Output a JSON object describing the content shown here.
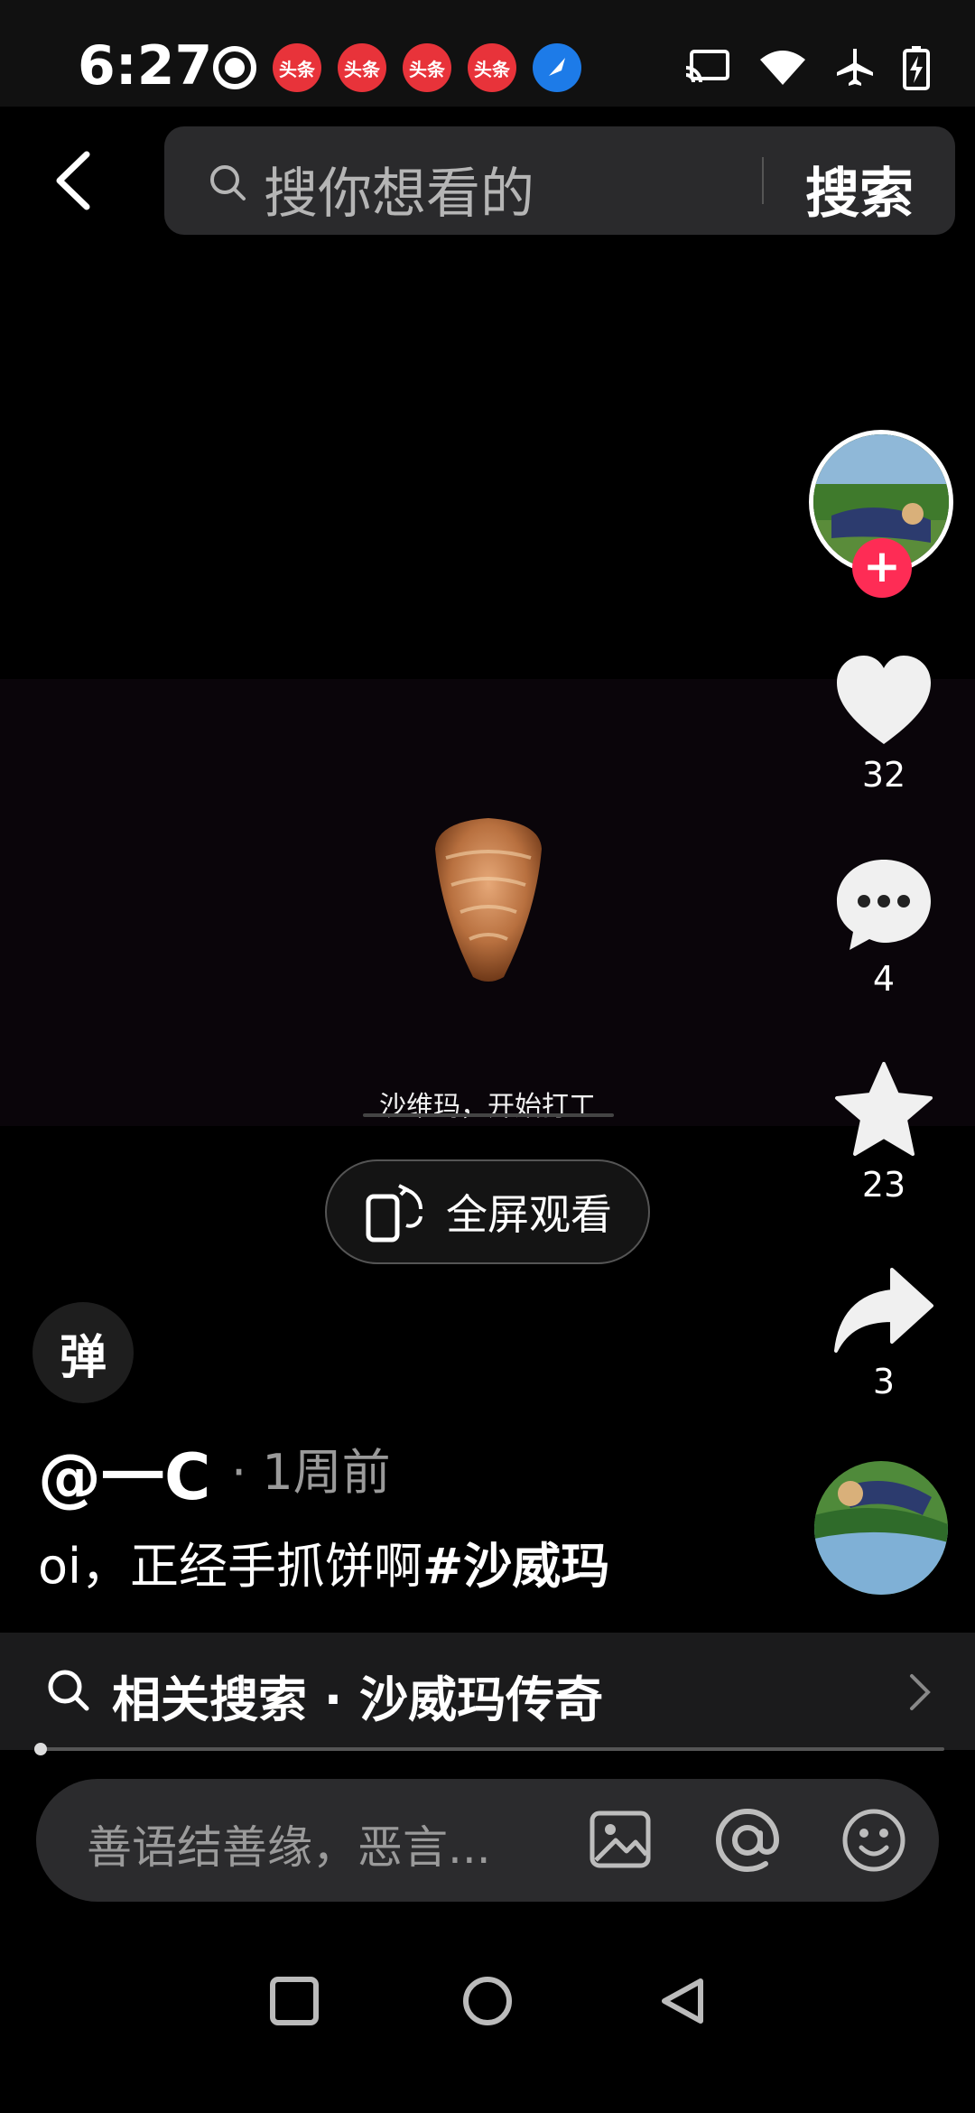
{
  "status_bar": {
    "time": "6:27",
    "badge_label": "头条"
  },
  "search": {
    "placeholder": "搜你想看的",
    "button_label": "搜索"
  },
  "video": {
    "subtitle": "沙维玛，开始打工",
    "fullscreen_label": "全屏观看"
  },
  "actions": {
    "like_count": "32",
    "comment_count": "4",
    "favorite_count": "23",
    "share_count": "3"
  },
  "post": {
    "danmaku_label": "弹",
    "author": "@一C",
    "time": "· 1周前",
    "caption_text": "oi，正经手抓饼啊",
    "caption_tag": "#沙威玛"
  },
  "related": {
    "text": "相关搜索 · 沙威玛传奇"
  },
  "comment": {
    "placeholder": "善语结善缘，恶言..."
  },
  "colors": {
    "accent_red": "#fe2c55",
    "badge_red": "#e8333a",
    "badge_blue": "#1d7be8"
  }
}
